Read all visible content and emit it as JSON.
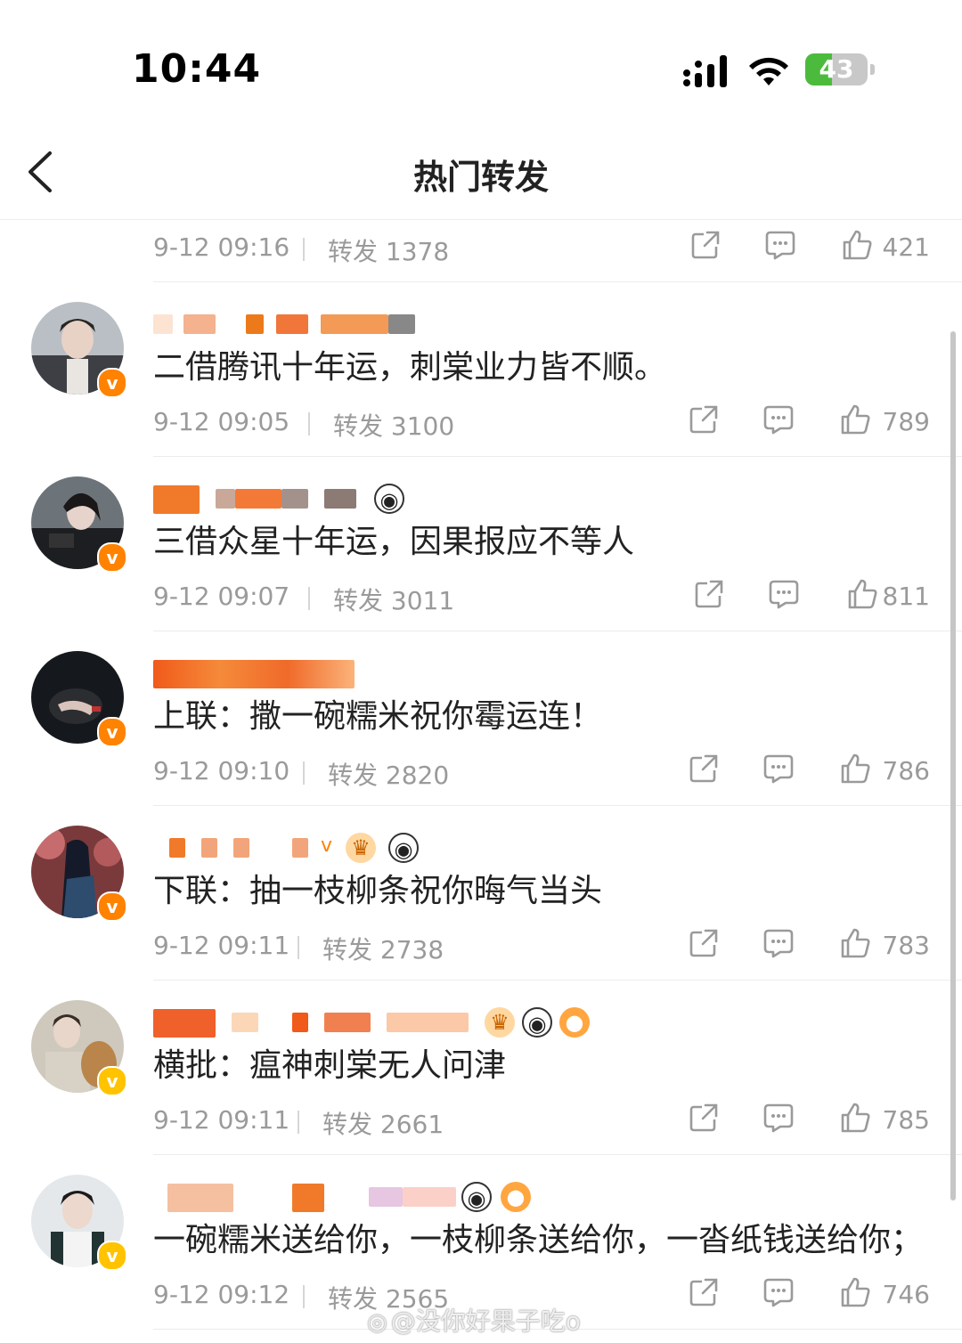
{
  "status_bar": {
    "time": "10:44",
    "battery": "43",
    "battery_level": 0.43
  },
  "nav": {
    "title": "热门转发"
  },
  "first_meta": {
    "time": "9-12 09:16",
    "forward": "转发 1378",
    "likes": "421"
  },
  "comments": [
    {
      "text": "二借腾讯十年运，刺棠业力皆不顺。",
      "time": "9-12 09:05",
      "forward": "转发 3100",
      "likes": "789",
      "badge": "orange"
    },
    {
      "text": "三借众星十年运，因果报应不等人",
      "time": "9-12 09:07",
      "forward": "转发 3011",
      "likes": "811",
      "badge": "orange"
    },
    {
      "text": "上联：撒一碗糯米祝你霉运连！",
      "time": "9-12 09:10",
      "forward": "转发 2820",
      "likes": "786",
      "badge": "orange"
    },
    {
      "text": "下联：抽一枝柳条祝你晦气当头",
      "time": "9-12 09:11",
      "forward": "转发 2738",
      "likes": "783",
      "badge": "orange"
    },
    {
      "text": "横批：瘟神刺棠无人问津",
      "time": "9-12 09:11",
      "forward": "转发 2661",
      "likes": "785",
      "badge": "yellow"
    },
    {
      "text": "一碗糯米送给你，一枝柳条送给你，一沓纸钱送给你；",
      "time": "9-12 09:12",
      "forward": "转发 2565",
      "likes": "746",
      "badge": "yellow"
    }
  ],
  "badges": {
    "verified": "v"
  },
  "watermark": "@没你好果子吃o",
  "colors": {
    "accent": "#ff8200",
    "battery_green": "#4cbb3d",
    "meta_gray": "#9a9a9a"
  }
}
